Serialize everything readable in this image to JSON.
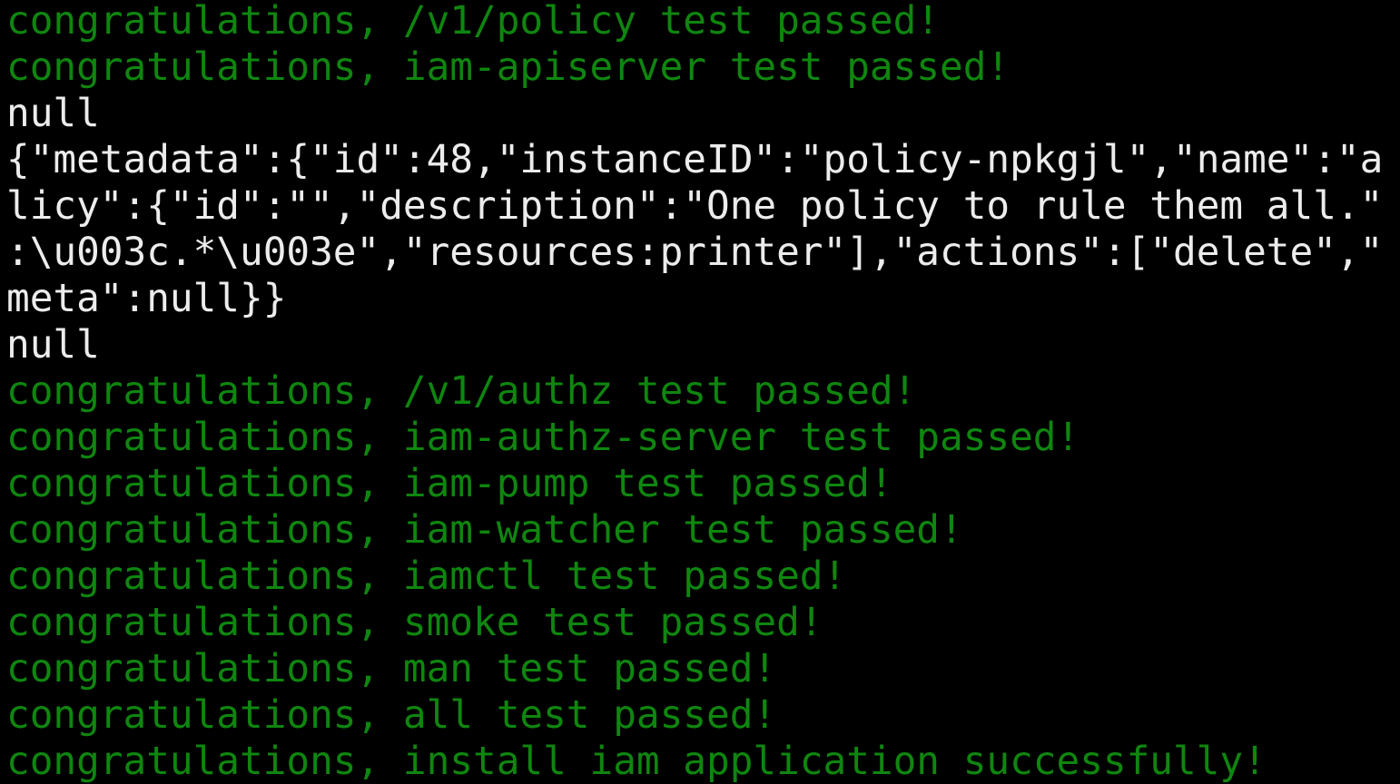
{
  "terminal": {
    "colors": {
      "background": "#000000",
      "success_text": "#0f860f",
      "plain_text": "#ececec"
    },
    "lines": [
      {
        "text": "congratulations, /v1/policy test passed!",
        "style": "green"
      },
      {
        "text": "congratulations, iam-apiserver test passed!",
        "style": "green"
      },
      {
        "text": "null",
        "style": "white"
      },
      {
        "text": "{\"metadata\":{\"id\":48,\"instanceID\":\"policy-npkgjl\",\"name\":\"a",
        "style": "white"
      },
      {
        "text": "licy\":{\"id\":\"\",\"description\":\"One policy to rule them all.\"",
        "style": "white"
      },
      {
        "text": ":\\u003c.*\\u003e\",\"resources:printer\"],\"actions\":[\"delete\",\"",
        "style": "white"
      },
      {
        "text": "meta\":null}}",
        "style": "white"
      },
      {
        "text": "null",
        "style": "white"
      },
      {
        "text": "congratulations, /v1/authz test passed!",
        "style": "green"
      },
      {
        "text": "congratulations, iam-authz-server test passed!",
        "style": "green"
      },
      {
        "text": "congratulations, iam-pump test passed!",
        "style": "green"
      },
      {
        "text": "congratulations, iam-watcher test passed!",
        "style": "green"
      },
      {
        "text": "congratulations, iamctl test passed!",
        "style": "green"
      },
      {
        "text": "congratulations, smoke test passed!",
        "style": "green"
      },
      {
        "text": "congratulations, man test passed!",
        "style": "green"
      },
      {
        "text": "congratulations, all test passed!",
        "style": "green"
      },
      {
        "text": "congratulations, install iam application successfully!",
        "style": "green"
      }
    ]
  }
}
